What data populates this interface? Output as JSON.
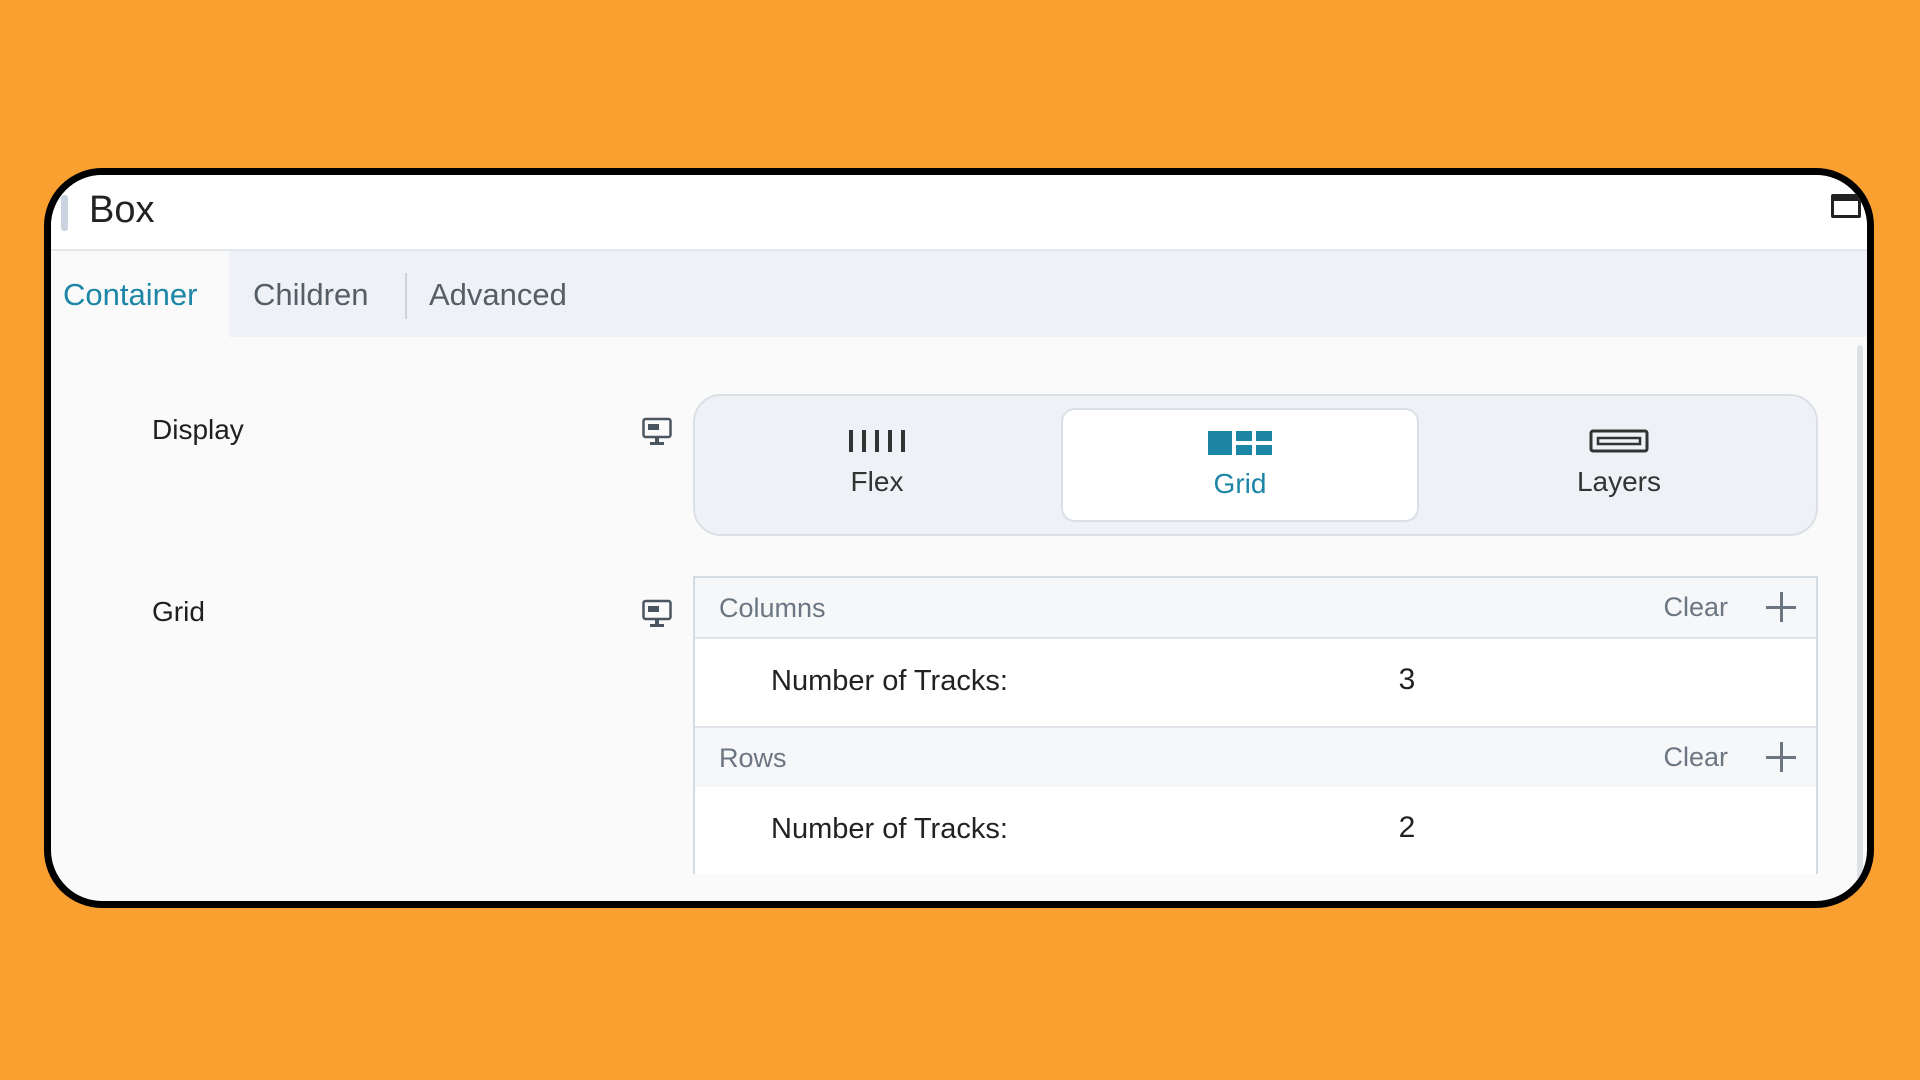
{
  "window": {
    "title": "Box"
  },
  "tabs": [
    {
      "label": "Container",
      "active": true
    },
    {
      "label": "Children",
      "active": false
    },
    {
      "label": "Advanced",
      "active": false
    }
  ],
  "display": {
    "label": "Display",
    "device_icon": "desktop-icon",
    "options": [
      {
        "label": "Flex",
        "icon": "flex-columns-icon",
        "active": false
      },
      {
        "label": "Grid",
        "icon": "grid-icon",
        "active": true
      },
      {
        "label": "Layers",
        "icon": "layers-icon",
        "active": false
      }
    ]
  },
  "grid": {
    "label": "Grid",
    "device_icon": "desktop-icon",
    "columns": {
      "title": "Columns",
      "clear_label": "Clear",
      "tracks_label": "Number of Tracks:",
      "tracks_value": "3"
    },
    "rows": {
      "title": "Rows",
      "clear_label": "Clear",
      "tracks_label": "Number of Tracks:",
      "tracks_value": "2"
    }
  },
  "colors": {
    "background": "#f9a030",
    "accent": "#1d86a6",
    "text": "#222222",
    "muted": "#6b7682"
  }
}
